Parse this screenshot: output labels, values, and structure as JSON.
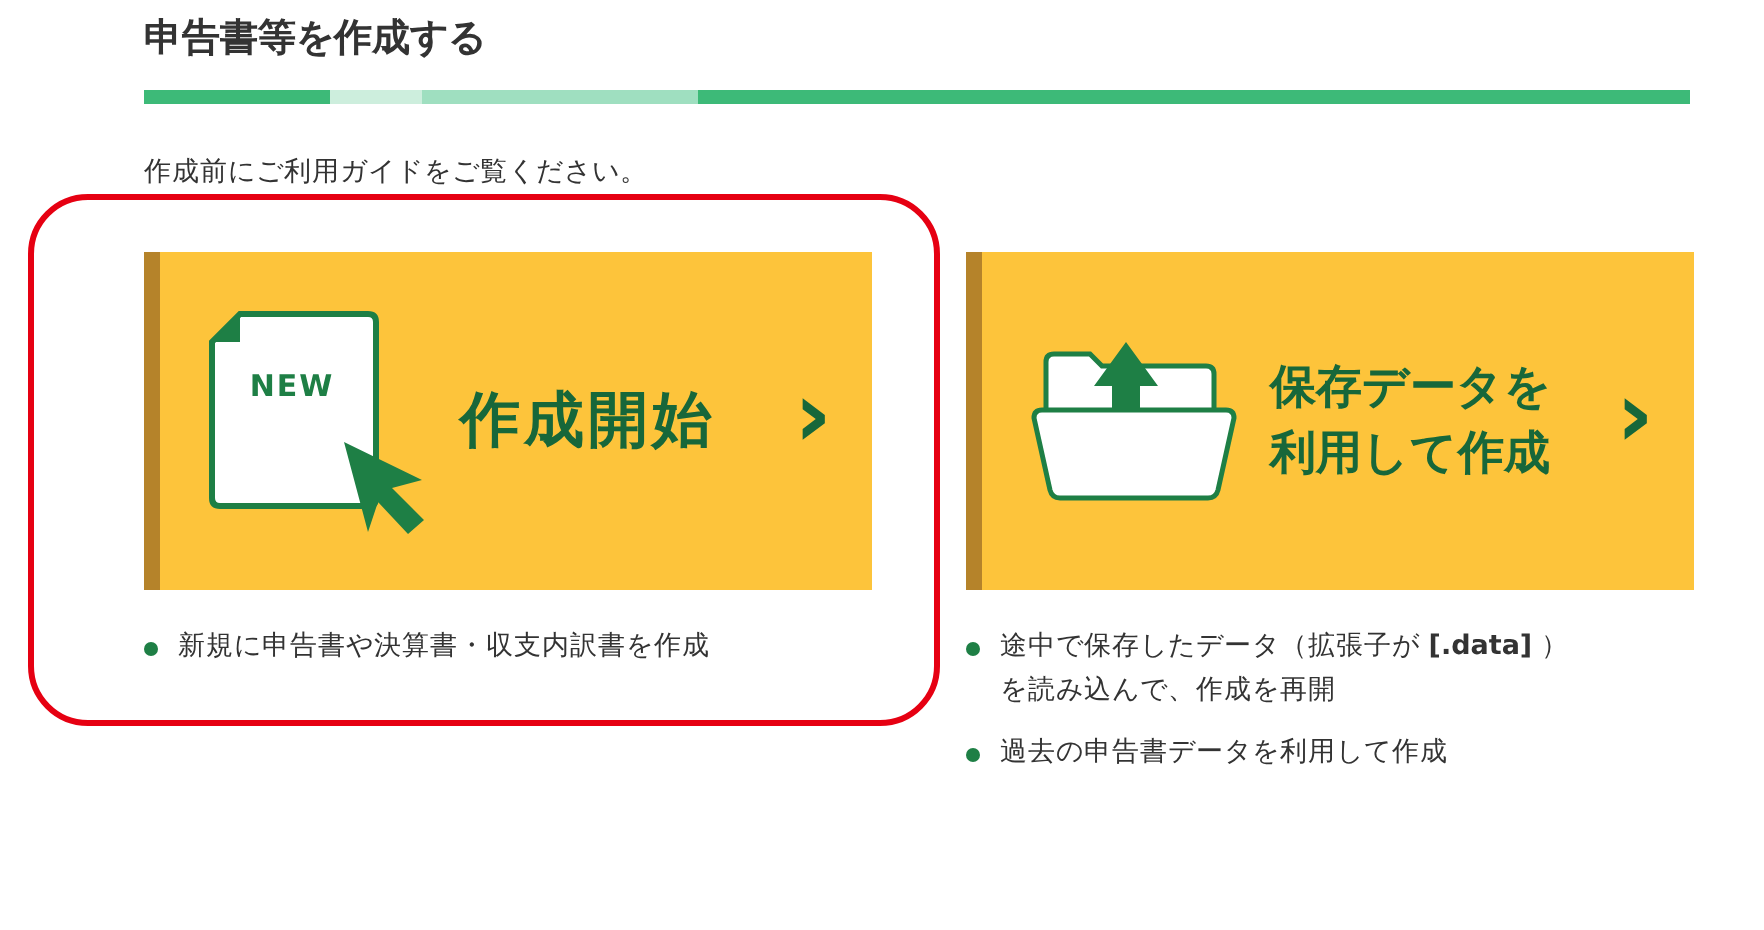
{
  "heading": "申告書等を作成する",
  "intro": "作成前にご利用ガイドをご覧ください。",
  "cards": [
    {
      "kind": "new",
      "icon_text": "NEW",
      "label": [
        "作成開始"
      ],
      "chevron": "›",
      "highlighted": true,
      "notes": [
        "新規に申告書や決算書・収支内訳書を作成"
      ]
    },
    {
      "kind": "saved",
      "label": [
        "保存データを",
        "利用して作成"
      ],
      "chevron": "›",
      "highlighted": false,
      "notes": [
        "途中で保存したデータ（拡張子が **[.data]** ）を読み込んで、作成を再開",
        "過去の申告書データを利用して作成"
      ]
    }
  ]
}
